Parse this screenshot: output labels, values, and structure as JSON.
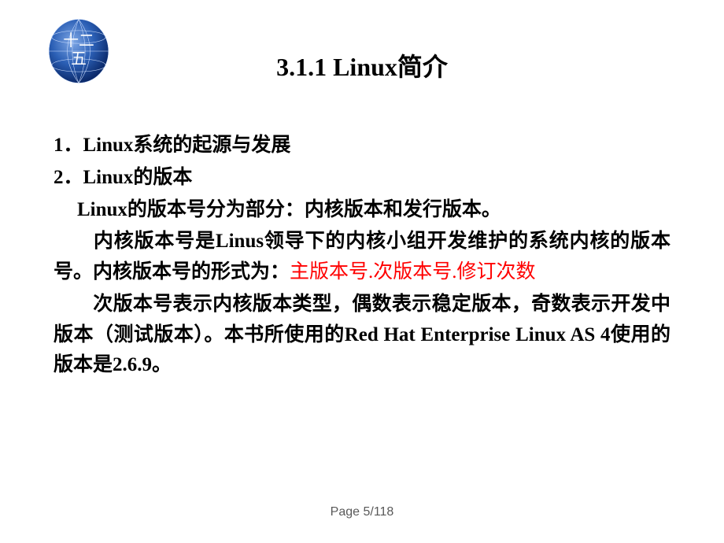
{
  "logo": {
    "text_top": "十二",
    "text_bottom": "五"
  },
  "title": "3.1.1 Linux简介",
  "content": {
    "item1": "1．Linux系统的起源与发展",
    "item2": "2．Linux的版本",
    "para1": "Linux的版本号分为部分：内核版本和发行版本。",
    "para2a": "内核版本号是Linus领导下的内核小组开发维护的系统内核的版本号。内核版本号的形式为：",
    "para2b": "主版本号.次版本号.修订次数",
    "para3": "次版本号表示内核版本类型，偶数表示稳定版本，奇数表示开发中版本（测试版本）。本书所使用的Red Hat Enterprise Linux AS 4使用的版本是2.6.9。"
  },
  "footer": "Page 5/118"
}
